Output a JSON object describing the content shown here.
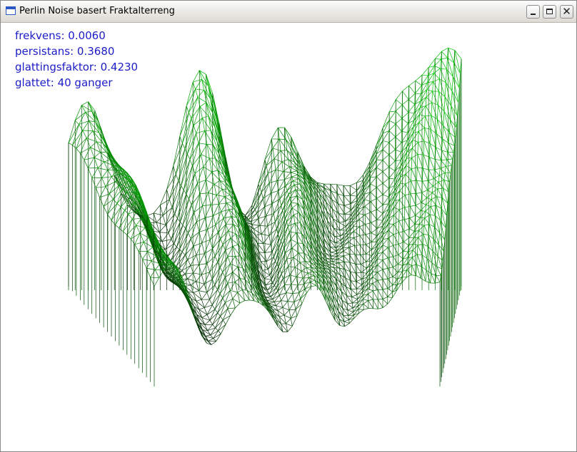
{
  "window": {
    "title": "Perlin Noise basert Fraktalterreng",
    "icons": {
      "app": "app-window-icon",
      "minimize": "minimize-icon",
      "maximize": "maximize-icon",
      "close": "close-icon"
    }
  },
  "hud": {
    "frequency": "frekvens: 0.0060",
    "persistence": "persistans: 0.3680",
    "smoothing_factor": "glattingsfaktor: 0.4230",
    "smoothed": "glattet: 40 ganger"
  },
  "colors": {
    "hud_text": "#1c1cc8",
    "terrain_high": "#00c400",
    "terrain_low": "#0a1a0a",
    "background": "#ffffff"
  }
}
